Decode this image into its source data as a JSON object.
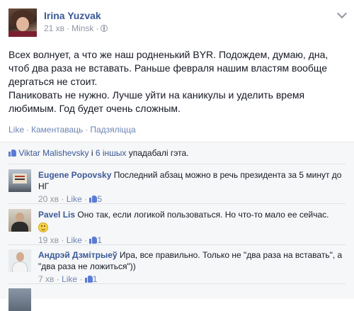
{
  "post": {
    "author": "Irina Yuzvak",
    "time": "21 хв",
    "location": "Minsk",
    "paragraphs": [
      "Всех волнует, а что же наш родненький BYR. Подождем, думаю, дна, чтоб два раза не вставать. Раньше февраля нашим властям вообще дергаться не стоит.",
      "Паниковать не нужно. Лучше уйти на каникулы и уделить время любимым. Год будет очень сложным."
    ],
    "actions": [
      "Like",
      "Каментаваць",
      "Падзяліцца"
    ]
  },
  "likes": {
    "names": "Viktar Malishevsky",
    "conj": "і",
    "others": "6 іншых",
    "suffix": "упадабалі гэта."
  },
  "comments": [
    {
      "name": "Eugene Popovsky",
      "text": "Последний абзац можно в речь президента за 5 минут до НГ",
      "time": "20 хв",
      "like": "Like",
      "count": "5"
    },
    {
      "name": "Pavel Lis",
      "text": "Оно так, если логикой пользоваться. Но что-то мало ее сейчас.",
      "time": "19 хв",
      "like": "Like",
      "count": "1"
    },
    {
      "name": "Андрэй Дзмітрыеў",
      "text": "Ира, все правильно. Только не \"два раза на вставать\", а \"два раза не ложиться\"))",
      "time": "7 хв",
      "like": "Like",
      "count": "1"
    },
    {
      "name": "",
      "text": "",
      "time": "",
      "like": "",
      "count": ""
    }
  ],
  "icons": {
    "privacy": "globe-icon",
    "menu": "chevron-down-icon",
    "like": "thumb-up-icon",
    "emoji": "smile-icon"
  },
  "colors": {
    "link": "#3b5998",
    "meta": "#9197a3",
    "ufi_bg": "#f6f7f8"
  }
}
